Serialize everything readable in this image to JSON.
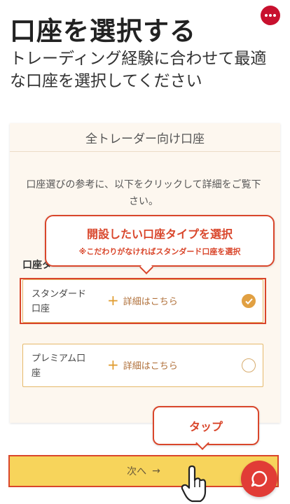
{
  "header": {
    "title": "口座を選択する",
    "subtitle": "トレーディング経験に合わせて最適な口座を選択してください"
  },
  "card": {
    "header": "全トレーダー向け口座",
    "intro": "口座選びの参考に、以下をクリックして詳細をご覧下さい。",
    "section_label": "口座タ"
  },
  "callout": {
    "title": "開設したい口座タイプを選択",
    "note": "※こだわりがなければスタンダード口座を選択"
  },
  "options": [
    {
      "name": "スタンダード口座",
      "detail": "詳細はこちら",
      "selected": true
    },
    {
      "name": "プレミアム口座",
      "detail": "詳細はこちら",
      "selected": false
    }
  ],
  "tap_callout": "タップ",
  "next_button": {
    "label": "次へ",
    "arrow": "→"
  },
  "icons": [
    "menu-dots-icon",
    "plus-icon",
    "check-icon",
    "hand-pointer-icon",
    "chat-icon"
  ],
  "colors": {
    "accent_red": "#d9462b",
    "button_yellow": "#f7d45b",
    "radio_orange": "#e1a042",
    "menu_red": "#c8102e"
  }
}
